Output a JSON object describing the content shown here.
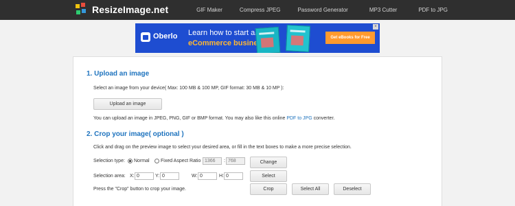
{
  "header": {
    "logo_text": "ResizeImage.net",
    "nav": [
      "GIF Maker",
      "Compress JPEG",
      "Password Generator",
      "MP3 Cutter",
      "PDF to JPG"
    ],
    "logo_colors": [
      "#f1c40f",
      "#e74c3c",
      "#2ecc71",
      "#3498db"
    ]
  },
  "ad": {
    "brand": "Oberlo",
    "line1": "Learn how to start an",
    "line2": "eCommerce business",
    "cta": "Get eBooks for Free",
    "close": "×"
  },
  "upload": {
    "heading": "1. Upload an image",
    "instructions": "Select an image from your device( Max: 100 MB & 100 MP, GIF format: 30 MB & 10 MP ):",
    "button": "Upload an image",
    "formats_prefix": "You can upload an image in JPEG, PNG, GIF or BMP format. You may also like this online ",
    "formats_link": "PDF to JPG",
    "formats_suffix": " converter."
  },
  "crop": {
    "heading": "2. Crop your image( optional )",
    "instructions": "Click and drag on the preview image to select your desired area, or fill in the text boxes to make a more precise selection.",
    "selection_type_label": "Selection type:",
    "option_normal": "Normal",
    "option_fixed": "Fixed Aspect Ratio",
    "ratio_w": "1366",
    "ratio_sep": ":",
    "ratio_h": "768",
    "change_button": "Change",
    "selection_area_label": "Selection area:",
    "x_label": "X:",
    "x_value": "0",
    "y_label": "Y:",
    "y_value": "0",
    "w_label": "W:",
    "w_value": "0",
    "h_label": "H:",
    "h_value": "0",
    "select_button": "Select",
    "hint": "Press the \"Crop\" button to crop your image.",
    "crop_button": "Crop",
    "select_all_button": "Select All",
    "deselect_button": "Deselect"
  }
}
